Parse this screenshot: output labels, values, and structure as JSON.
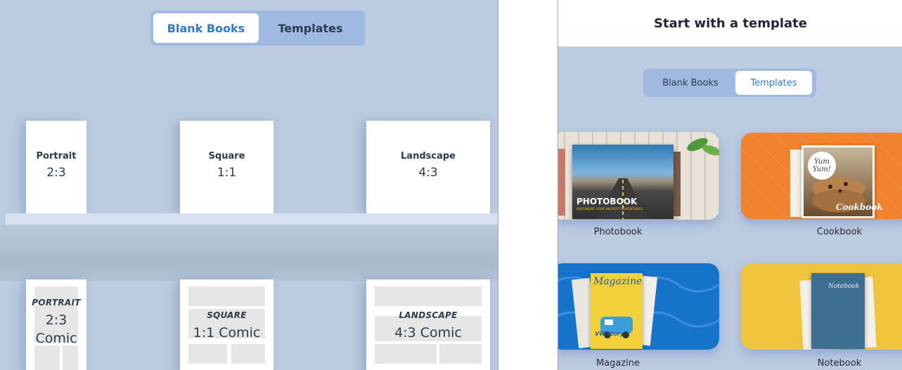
{
  "left": {
    "segmented": {
      "blank_books": "Blank Books",
      "templates": "Templates",
      "selected": "Blank Books"
    },
    "books": [
      {
        "title": "Portrait",
        "ratio": "2:3"
      },
      {
        "title": "Square",
        "ratio": "1:1"
      },
      {
        "title": "Landscape",
        "ratio": "4:3"
      }
    ],
    "comics": [
      {
        "title": "PORTRAIT",
        "ratio_line1": "2:3",
        "ratio_line2": "Comic"
      },
      {
        "title": "SQUARE",
        "ratio_line1": "1:1 Comic"
      },
      {
        "title": "LANDSCAPE",
        "ratio_line1": "4:3 Comic"
      }
    ]
  },
  "right": {
    "header_title": "Start with a template",
    "segmented": {
      "blank_books": "Blank Books",
      "templates": "Templates",
      "selected": "Templates"
    },
    "cards": [
      {
        "label": "Photobook",
        "cover_title": "PHOTOBOOK",
        "cover_subtitle": "DOCUMENT YOUR WILDEST ADVENTURES"
      },
      {
        "label": "Cookbook",
        "cover_title": "Yum Yum!",
        "cover_subtitle": "Cookbook"
      },
      {
        "label": "Magazine",
        "cover_title": "Magazine",
        "cover_subtitle": "VW story"
      },
      {
        "label": "Notebook",
        "cover_title": "Notebook"
      }
    ]
  },
  "colors": {
    "accent": "#2a7bd6",
    "panel_bg": "#bccbdf",
    "segment_bg": "#9fb9e0",
    "cookbook_bg": "#f3822f",
    "magazine_bg": "#1673c9",
    "notebook_bg": "#f0c43d"
  }
}
